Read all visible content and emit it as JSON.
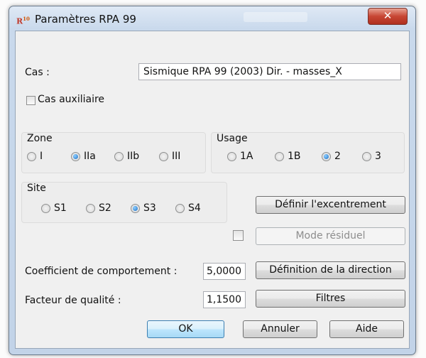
{
  "window": {
    "title": "Paramètres RPA 99",
    "app_icon_text": "R",
    "app_icon_sup": "10",
    "close_label": "✕"
  },
  "cas": {
    "label": "Cas :",
    "value": "Sismique RPA 99 (2003) Dir. - masses_X"
  },
  "cas_auxiliaire": {
    "label": "Cas auxiliaire",
    "checked": false
  },
  "zone": {
    "label": "Zone",
    "options": [
      "I",
      "IIa",
      "IIb",
      "III"
    ],
    "selected": "IIa"
  },
  "usage": {
    "label": "Usage",
    "options": [
      "1A",
      "1B",
      "2",
      "3"
    ],
    "selected": "2"
  },
  "site": {
    "label": "Site",
    "options": [
      "S1",
      "S2",
      "S3",
      "S4"
    ],
    "selected": "S3"
  },
  "buttons": {
    "excentrement": "Définir l'excentrement",
    "mode_residuel": "Mode résiduel",
    "direction": "Définition de la direction",
    "filtres": "Filtres",
    "ok": "OK",
    "annuler": "Annuler",
    "aide": "Aide"
  },
  "mode_residuel_checked": false,
  "coefficient": {
    "label": "Coefficient de comportement :",
    "value": "5,0000"
  },
  "facteur": {
    "label": "Facteur de qualité :",
    "value": "1,1500"
  }
}
